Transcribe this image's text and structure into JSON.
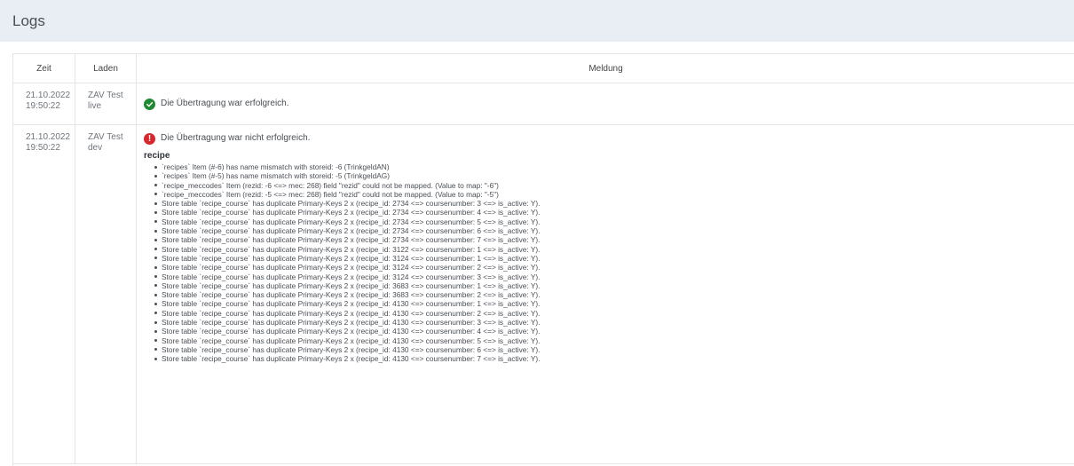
{
  "page": {
    "title": "Logs"
  },
  "table": {
    "headers": {
      "zeit": "Zeit",
      "laden": "Laden",
      "meldung": "Meldung"
    },
    "rows": [
      {
        "date": "21.10.2022",
        "time": "19:50:22",
        "store": "ZAV Test",
        "env": "live",
        "status": "success",
        "message": "Die Übertragung war erfolgreich."
      },
      {
        "date": "21.10.2022",
        "time": "19:50:22",
        "store": "ZAV Test",
        "env": "dev",
        "status": "error",
        "message": "Die Übertragung war nicht erfolgreich.",
        "section": "recipe",
        "details": [
          "`recipes` Item (#-6) has name mismatch with storeid: -6 (TrinkgeldAN)",
          "`recipes` Item (#-5) has name mismatch with storeid: -5 (TrinkgeldAG)",
          "`recipe_meccodes` Item (rezid: -6 <=> mec: 268) field \"rezid\" could not be mapped. (Value to map: \"-6\")",
          "`recipe_meccodes` Item (rezid: -5 <=> mec: 268) field \"rezid\" could not be mapped. (Value to map: \"-5\")",
          "Store table `recipe_course` has duplicate Primary-Keys 2 x (recipe_id: 2734 <=> coursenumber: 3 <=> is_active: Y).",
          "Store table `recipe_course` has duplicate Primary-Keys 2 x (recipe_id: 2734 <=> coursenumber: 4 <=> is_active: Y).",
          "Store table `recipe_course` has duplicate Primary-Keys 2 x (recipe_id: 2734 <=> coursenumber: 5 <=> is_active: Y).",
          "Store table `recipe_course` has duplicate Primary-Keys 2 x (recipe_id: 2734 <=> coursenumber: 6 <=> is_active: Y).",
          "Store table `recipe_course` has duplicate Primary-Keys 2 x (recipe_id: 2734 <=> coursenumber: 7 <=> is_active: Y).",
          "Store table `recipe_course` has duplicate Primary-Keys 2 x (recipe_id: 3122 <=> coursenumber: 1 <=> is_active: Y).",
          "Store table `recipe_course` has duplicate Primary-Keys 2 x (recipe_id: 3124 <=> coursenumber: 1 <=> is_active: Y).",
          "Store table `recipe_course` has duplicate Primary-Keys 2 x (recipe_id: 3124 <=> coursenumber: 2 <=> is_active: Y).",
          "Store table `recipe_course` has duplicate Primary-Keys 2 x (recipe_id: 3124 <=> coursenumber: 3 <=> is_active: Y).",
          "Store table `recipe_course` has duplicate Primary-Keys 2 x (recipe_id: 3683 <=> coursenumber: 1 <=> is_active: Y).",
          "Store table `recipe_course` has duplicate Primary-Keys 2 x (recipe_id: 3683 <=> coursenumber: 2 <=> is_active: Y).",
          "Store table `recipe_course` has duplicate Primary-Keys 2 x (recipe_id: 4130 <=> coursenumber: 1 <=> is_active: Y).",
          "Store table `recipe_course` has duplicate Primary-Keys 2 x (recipe_id: 4130 <=> coursenumber: 2 <=> is_active: Y).",
          "Store table `recipe_course` has duplicate Primary-Keys 2 x (recipe_id: 4130 <=> coursenumber: 3 <=> is_active: Y).",
          "Store table `recipe_course` has duplicate Primary-Keys 2 x (recipe_id: 4130 <=> coursenumber: 4 <=> is_active: Y).",
          "Store table `recipe_course` has duplicate Primary-Keys 2 x (recipe_id: 4130 <=> coursenumber: 5 <=> is_active: Y).",
          "Store table `recipe_course` has duplicate Primary-Keys 2 x (recipe_id: 4130 <=> coursenumber: 6 <=> is_active: Y).",
          "Store table `recipe_course` has duplicate Primary-Keys 2 x (recipe_id: 4130 <=> coursenumber: 7 <=> is_active: Y)."
        ]
      }
    ]
  },
  "icons": {
    "success": "check-circle-icon",
    "error": "exclamation-circle-icon"
  },
  "colors": {
    "header_bg": "#e9eef4",
    "success": "#1f8a33",
    "error": "#d6262e"
  }
}
